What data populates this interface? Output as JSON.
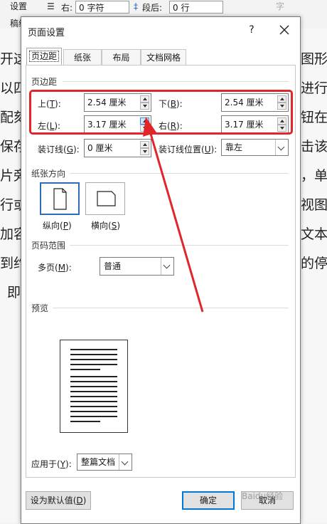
{
  "ribbon": {
    "left_text": "设置",
    "left_text2": "稿纸",
    "indent_right_label": "右:",
    "indent_right_value": "0 字符",
    "space_after_label": "段后:",
    "space_after_value": "0 行",
    "faded_char": "字"
  },
  "document": {
    "line_starts": [
      "开这",
      "以四",
      "配刻",
      "保存",
      "片旁",
      "行或",
      "加容",
      "到约",
      "即"
    ],
    "line_ends": [
      "图形",
      "进行",
      "钮在",
      "击该",
      "，单",
      "视图",
      "文本。",
      "的停"
    ]
  },
  "dialog": {
    "title": "页面设置",
    "help": "?",
    "tabs": [
      "页边距",
      "纸张",
      "布局",
      "文档网格"
    ],
    "margins": {
      "section": "页边距",
      "top_label": "上(",
      "top_key": "T",
      "top_value": "2.54 厘米",
      "bottom_label": "下(",
      "bottom_key": "B",
      "bottom_value": "2.54 厘米",
      "left_label": "左(",
      "left_key": "L",
      "left_value": "3.17 厘米",
      "right_label": "右(",
      "right_key": "R",
      "right_value": "3.17 厘米",
      "gutter_label": "装订线(",
      "gutter_key": "G",
      "gutter_value": "0 厘米",
      "gutter_pos_label": "装订线位置(",
      "gutter_pos_key": "U",
      "gutter_pos_value": "靠左"
    },
    "orientation": {
      "section": "纸张方向",
      "portrait": "纵向(",
      "portrait_key": "P",
      "landscape": "横向(",
      "landscape_key": "S"
    },
    "pages": {
      "section": "页码范围",
      "multi_label": "多页(",
      "multi_key": "M",
      "multi_value": "普通"
    },
    "preview": {
      "section": "预览",
      "apply_label": "应用于(",
      "apply_key": "Y",
      "apply_value": "整篇文档"
    },
    "buttons": {
      "default": "设为默认值(",
      "default_key": "D",
      "ok": "确定",
      "cancel": "取消"
    }
  },
  "watermark": "Baidu经验"
}
